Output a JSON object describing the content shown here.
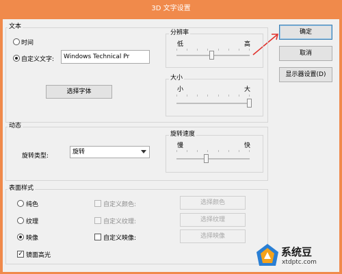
{
  "window": {
    "title": "3D 文字设置"
  },
  "buttons": {
    "ok": "确定",
    "cancel": "取消",
    "display": "显示器设置(D)"
  },
  "text_group": {
    "label": "文本",
    "radio_time": "时间",
    "radio_custom": "自定义文字:",
    "custom_value": "Windows Technical Pr",
    "choose_font": "选择字体",
    "resolution": {
      "label": "分辨率",
      "min": "低",
      "max": "高",
      "level": 0.49
    },
    "size": {
      "label": "大小",
      "min": "小",
      "max": "大",
      "level": 1.0
    }
  },
  "motion_group": {
    "label": "动态",
    "type_label": "旋转类型:",
    "type_value": "旋转",
    "speed": {
      "label": "旋转速度",
      "min": "慢",
      "max": "快",
      "level": 0.42
    }
  },
  "surface_group": {
    "label": "表面样式",
    "solid": "纯色",
    "texture": "纹理",
    "reflection": "映像",
    "custom_color": "自定义颜色:",
    "custom_texture": "自定义纹理:",
    "custom_reflection": "自定义映像:",
    "choose_color": "选择颜色",
    "choose_texture": "选择纹理",
    "choose_reflection": "选择映像",
    "specular": "镜面高光"
  },
  "watermark": {
    "text": "系统豆",
    "url": "xtdptc.com"
  },
  "colors": {
    "titlebar": "#f08a4b",
    "watermark_text": "#1a1a1a",
    "logo_orange": "#f5a21b",
    "logo_blue": "#2a7fd4"
  }
}
